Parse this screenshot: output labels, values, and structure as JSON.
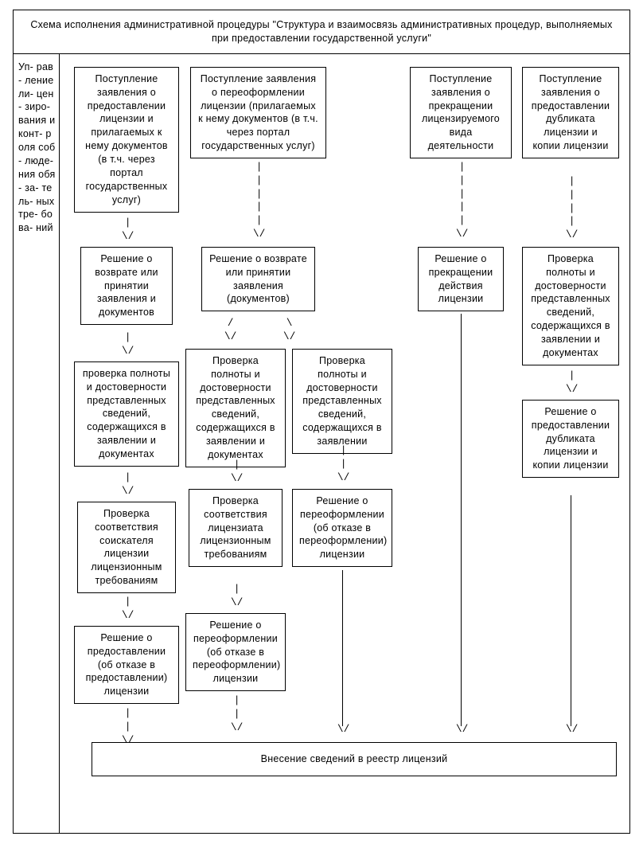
{
  "title": "Схема исполнения административной процедуры \"Структура и взаимосвязь административных процедур, выполняемых при предоставлении государственной услуги\"",
  "side_label": "Уп- рав- ление ли- цен- зиро- вания и конт- роля соб- люде- ния обя- за- тель- ных тре- бова- ний",
  "col1": {
    "r1": "Поступление заявления о предоставлении лицензии и прилагаемых к нему документов (в т.ч. через портал государственных услуг)",
    "r2": "Решение о возврате или принятии заявления и документов",
    "r3": "проверка полноты и достоверности представленных сведений, содержащихся в заявлении и документах",
    "r4": "Проверка соответствия соискателя лицензии лицензионным требованиям",
    "r5": "Решение о предоставлении (об отказе в предоставлении) лицензии"
  },
  "col2": {
    "r1": "Поступление заявления о переоформлении лицензии (прилагаемых к нему документов (в т.ч. через портал государственных услуг)",
    "r2": "Решение о возврате или принятии заявления (документов)",
    "r3a": "Проверка полноты и достоверности представленных сведений, содержащихся в заявлении и документах",
    "r3b": "Проверка полноты и достоверности представленных сведений, содержащихся в заявлении",
    "r4a": "Проверка соответствия лицензиата лицензионным требованиям",
    "r4b": "Решение о переоформлении (об отказе в переоформлении) лицензии",
    "r5": "Решение о переоформлении (об отказе в переоформлении) лицензии"
  },
  "col3": {
    "r1": "Поступление заявления о прекращении лицензируемого вида деятельности",
    "r2": "Решение о прекращении действия лицензии"
  },
  "col4": {
    "r1": "Поступление заявления о предоставлении дубликата лицензии и копии лицензии",
    "r2": "Проверка полноты и достоверности представленных сведений, содержащихся в заявлении и документах",
    "r3": "Решение о предоставлении дубликата лицензии и копии лицензии"
  },
  "final": "Внесение сведений в реестр лицензий"
}
